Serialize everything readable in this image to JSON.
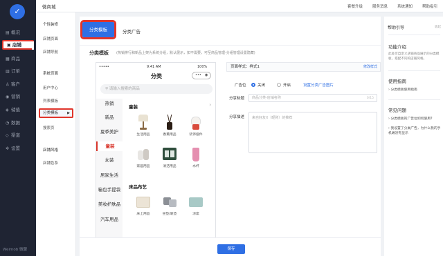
{
  "nav": {
    "logo_glyph": "✓",
    "items": [
      {
        "label": "概况",
        "icon": "chart-icon"
      },
      {
        "label": "店铺",
        "icon": "store-icon"
      },
      {
        "label": "商品",
        "icon": "goods-icon"
      },
      {
        "label": "订单",
        "icon": "order-icon"
      },
      {
        "label": "客户",
        "icon": "customer-icon"
      },
      {
        "label": "营销",
        "icon": "marketing-icon"
      },
      {
        "label": "储值",
        "icon": "wallet-icon"
      },
      {
        "label": "数据",
        "icon": "data-icon"
      },
      {
        "label": "渠道",
        "icon": "channel-icon"
      },
      {
        "label": "设置",
        "icon": "gear-icon"
      }
    ],
    "brand": "Weimob 微盟",
    "active_color": "#e0352b"
  },
  "topbar": {
    "title": "微商城",
    "links": [
      "套餐升级",
      "服务消息",
      "系统通知",
      "帮助指引"
    ]
  },
  "subnav": {
    "groups": [
      {
        "title": "个性装修",
        "items": [
          "店铺页面",
          "店铺导航"
        ]
      },
      {
        "title": "系统页面",
        "items": [
          "用户中心",
          "列表模板",
          "分类模板",
          "搜索页"
        ]
      },
      {
        "title": "店铺风格",
        "items": [
          "店铺色系"
        ]
      }
    ],
    "active_item": "分类模板"
  },
  "tabs": {
    "active": "分类模板",
    "other": "分类广告"
  },
  "section": {
    "title": "分类模板",
    "note": "(热销排行和新品上架为系统分组，默认展示，如不需要，可至商品管理-分组管理设置隐藏)"
  },
  "phone": {
    "status_left": "•••••",
    "time": "9:41 AM",
    "battery": "100%",
    "title": "分类",
    "search_placeholder": "请输入搜索的商品",
    "categories": [
      "热销",
      "新品",
      "夏季美护",
      "童装",
      "女装",
      "居家生活",
      "箱包手提袋",
      "美妆护肤品",
      "汽车用品"
    ],
    "active_category": "童装",
    "group1": {
      "title": "童装",
      "products": [
        "生活用品",
        "香薰用品",
        "装饰摆件",
        "家居用品",
        "清洁用品",
        "水杯"
      ]
    },
    "group2": {
      "title": "床品布艺",
      "products": [
        "床上用品",
        "坐垫/靠垫",
        "凉席"
      ]
    }
  },
  "form": {
    "style_label": "页面样式：样式1",
    "edit_link": "修改样式",
    "ad_label": "广告位",
    "ad_off": "关闭",
    "ad_on": "开启",
    "ad_link": "设置分类广告图片",
    "share_title_label": "分享标题",
    "share_title_placeholder": "商品分类-店铺名称",
    "share_title_count": "0/15",
    "share_desc_label": "分享描述",
    "share_desc_placeholder": "来自好友X（昵称）的推荐"
  },
  "footer": {
    "save": "保存"
  },
  "help": {
    "title": "帮助引导",
    "close": "收起",
    "intro_title": "功能介绍",
    "intro_desc": "此处可自定义店铺商品展示的分类模板，搭配不同的店铺风格。",
    "guide_title": "使用指南",
    "guide_links": [
      "分类模板使用指南"
    ],
    "faq_title": "常见问题",
    "faq_links": [
      "分类模板的广告位如何使用?",
      "我设置了分类广告，为什么我的手机端没有显示"
    ]
  }
}
